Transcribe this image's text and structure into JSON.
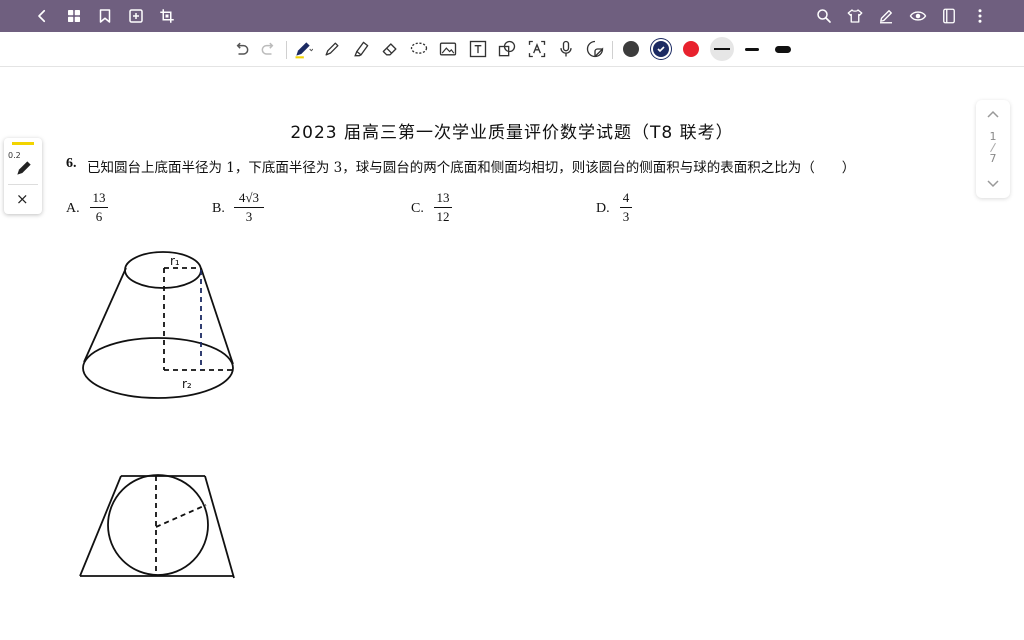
{
  "topbar": {
    "background": "#6f5f7f",
    "left_icons": [
      "back-icon",
      "grid-icon",
      "bookmark-icon",
      "add-page-icon",
      "crop-icon"
    ],
    "right_icons": [
      "search-icon",
      "shirt-icon",
      "pen-edit-icon",
      "eye-icon",
      "notebook-icon",
      "more-icon"
    ]
  },
  "toolbar": {
    "tools": [
      "undo-icon",
      "redo-icon",
      "pen-icon",
      "pencil-icon",
      "highlighter-icon",
      "eraser-icon",
      "lasso-icon",
      "image-icon",
      "text-box-icon",
      "shape-icon",
      "ocr-icon",
      "microphone-icon",
      "sticker-icon"
    ],
    "colors": [
      "#3c3c3c",
      "#1b2a63",
      "#e8222e"
    ],
    "stroke_widths": [
      "thin",
      "medium",
      "thick"
    ]
  },
  "pen_panel": {
    "size_label": "0.2",
    "accent": "#f2d400",
    "close_label": "×"
  },
  "page_nav": {
    "current": "1",
    "total": "7"
  },
  "document": {
    "title": "2023 届高三第一次学业质量评价数学试题（T8 联考）",
    "question_number": "6.",
    "question_text": "已知圆台上底面半径为 1，下底面半径为 3，球与圆台的两个底面和侧面均相切，则该圆台的侧面积与球的表面积之比为（　　）",
    "options": [
      {
        "label": "A.",
        "numerator": "13",
        "denominator": "6"
      },
      {
        "label": "B.",
        "numerator": "4√3",
        "denominator": "3"
      },
      {
        "label": "C.",
        "numerator": "13",
        "denominator": "12"
      },
      {
        "label": "D.",
        "numerator": "4",
        "denominator": "3"
      }
    ]
  },
  "annotations": {
    "r1_label": "r₁",
    "r2_label": "r₂"
  }
}
